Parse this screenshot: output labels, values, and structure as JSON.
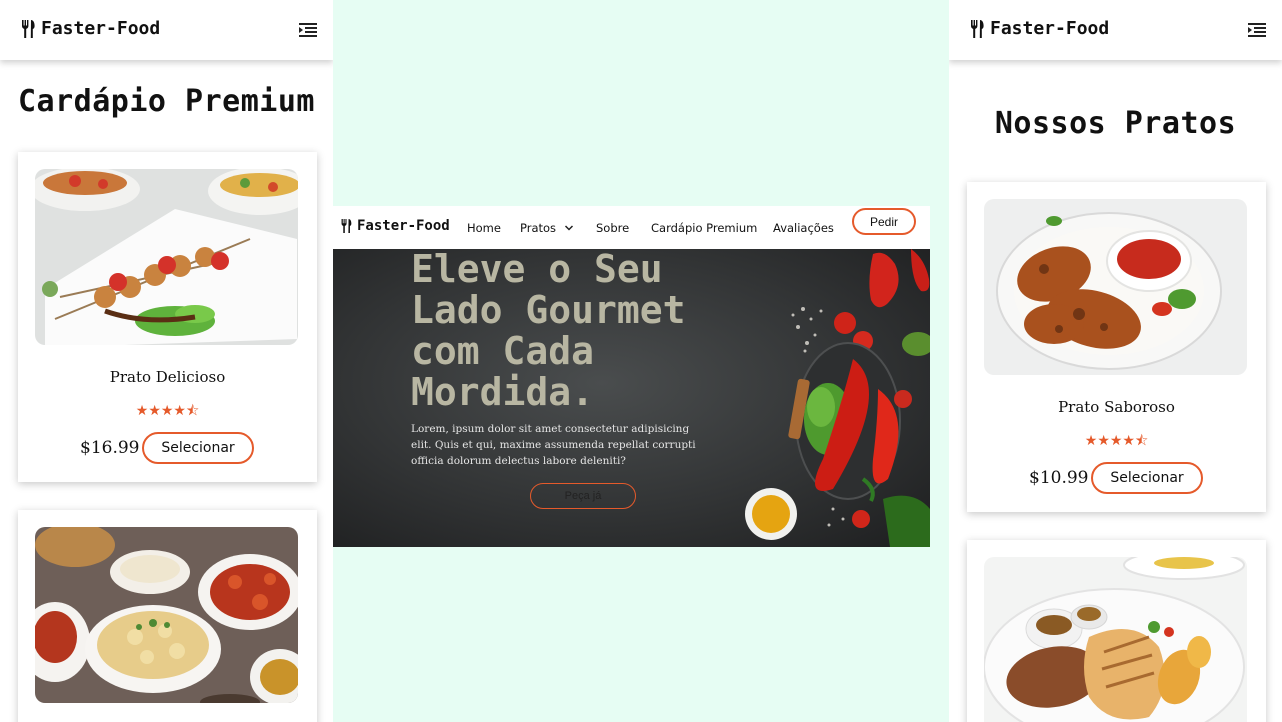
{
  "brand": {
    "name": "Faster-Food"
  },
  "left_panel": {
    "title": "Cardápio Premium",
    "cards": [
      {
        "name": "Prato Delicioso",
        "rating": 4.5,
        "stars": "★★★★⯪",
        "price": "$16.99",
        "button": "Selecionar"
      },
      {
        "name": "",
        "rating": null,
        "stars": "",
        "price": "",
        "button": ""
      }
    ]
  },
  "right_panel": {
    "title": "Nossos Pratos",
    "cards": [
      {
        "name": "Prato Saboroso",
        "rating": 4.5,
        "stars": "★★★★⯪",
        "price": "$10.99",
        "button": "Selecionar"
      },
      {
        "name": "",
        "rating": null,
        "stars": "",
        "price": "",
        "button": ""
      }
    ]
  },
  "desktop": {
    "nav": {
      "links": [
        "Home",
        "Pratos",
        "Sobre",
        "Cardápio Premium",
        "Avaliações"
      ],
      "cta": "Pedir"
    },
    "hero": {
      "title": "Eleve o Seu Lado Gourmet com Cada Mordida.",
      "text": "Lorem, ipsum dolor sit amet consectetur adipisicing elit. Quis et qui, maxime assumenda repellat corrupti officia dolorum delectus labore deleniti?",
      "button": "Peça já"
    }
  },
  "colors": {
    "accent": "#e55a2b",
    "page_bg": "#e6fdf3",
    "hero_title": "#b8b6a2"
  },
  "icons": [
    "fork-knife-icon",
    "menu-indent-icon",
    "chevron-down-icon",
    "star-icon"
  ]
}
